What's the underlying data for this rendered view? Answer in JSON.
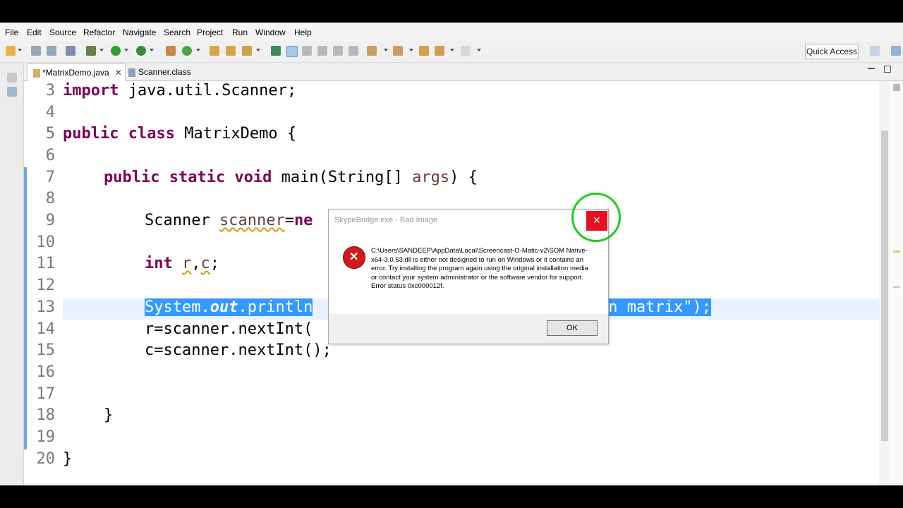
{
  "menu": [
    "File",
    "Edit",
    "Source",
    "Refactor",
    "Navigate",
    "Search",
    "Project",
    "Run",
    "Window",
    "Help"
  ],
  "quick_access": "Quick Access",
  "tabs": [
    {
      "label": "*MatrixDemo.java"
    },
    {
      "label": "Scanner.class"
    }
  ],
  "line_numbers": [
    "3",
    "4",
    "5",
    "6",
    "7",
    "8",
    "9",
    "10",
    "11",
    "12",
    "13",
    "14",
    "15",
    "16",
    "17",
    "18",
    "19",
    "20"
  ],
  "code": {
    "l3_kw": "import",
    "l3_rest": " java.util.Scanner;",
    "l5_kw": "public class",
    "l5_rest": " MatrixDemo {",
    "l7_kw": "public static void",
    "l7_rest1": " main(String[] ",
    "l7_var": "args",
    "l7_rest2": ") {",
    "l9_type": "Scanner ",
    "l9_var": "scanner",
    "l9_rest": "=",
    "l9_kw": "ne",
    "l11_kw": "int",
    "l11_rest": " ",
    "l11_r": "r",
    "l11_comma": ",",
    "l11_c": "c",
    "l11_semi": ";",
    "l13_sys": "System.",
    "l13_out": "out",
    "l13_println": ".println",
    "l13_tail": "in matrix\");",
    "l14": "r=scanner.nextInt(",
    "l15": "c=scanner.nextInt();",
    "l18": "}",
    "l20": "}"
  },
  "dialog": {
    "title": "SkypeBridge.exe - Bad Image",
    "message": "C:\\Users\\SANDEEP\\AppData\\Local\\Screencast-O-Matic-v2\\SOM Native-x64-3.0.53.dll is either not designed to run on Windows or it contains an error. Try installing the program again using the original installation media or contact your system administrator or the software vendor for support. Error status 0xc000012f.",
    "ok_label": "OK"
  }
}
